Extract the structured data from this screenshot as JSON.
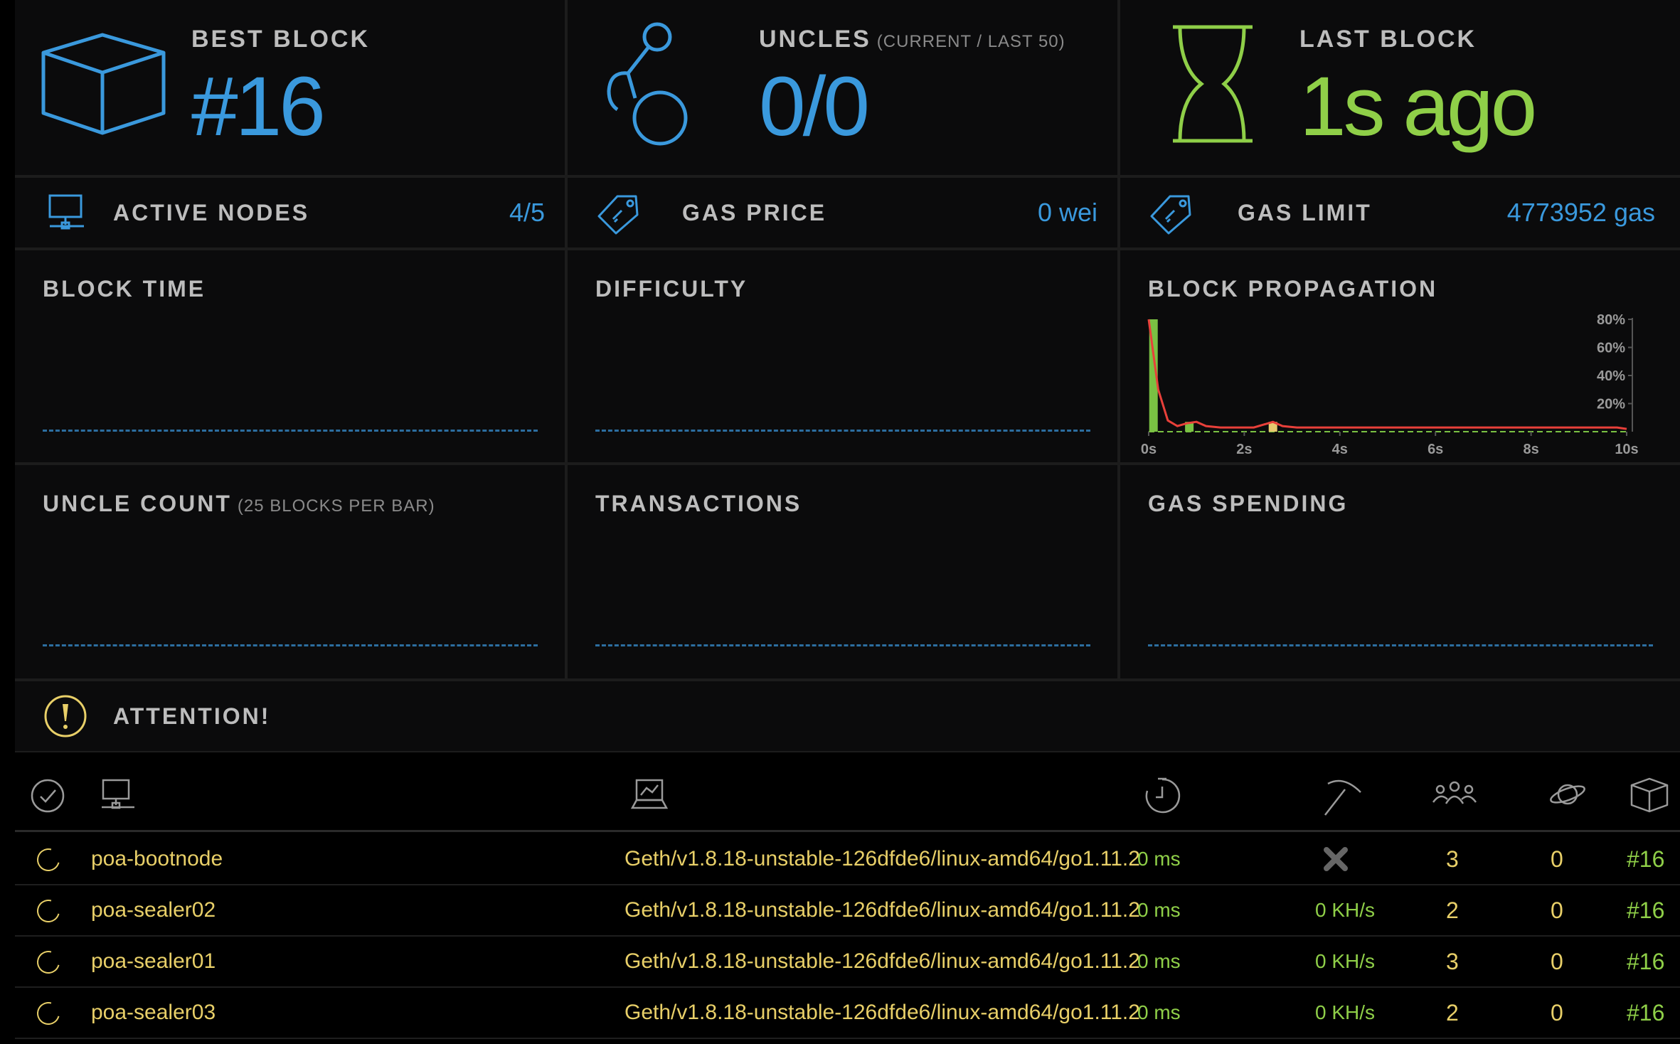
{
  "stats": {
    "best_block": {
      "label": "BEST BLOCK",
      "value": "#16"
    },
    "uncles": {
      "label": "UNCLES",
      "sublabel": "(CURRENT / LAST 50)",
      "value": "0/0"
    },
    "last_block": {
      "label": "LAST BLOCK",
      "value": "1s ago"
    },
    "active_nodes": {
      "label": "ACTIVE NODES",
      "value": "4/5"
    },
    "gas_price": {
      "label": "GAS PRICE",
      "value": "0 wei"
    },
    "gas_limit": {
      "label": "GAS LIMIT",
      "value": "4773952 gas"
    }
  },
  "charts": {
    "block_time": {
      "label": "BLOCK TIME"
    },
    "difficulty": {
      "label": "DIFFICULTY"
    },
    "uncle_count": {
      "label": "UNCLE COUNT",
      "sublabel": "(25 BLOCKS PER BAR)"
    },
    "transactions": {
      "label": "TRANSACTIONS"
    },
    "gas_spending": {
      "label": "GAS SPENDING"
    },
    "block_propagation": {
      "label": "BLOCK PROPAGATION"
    }
  },
  "chart_data": {
    "type": "bar",
    "title": "BLOCK PROPAGATION",
    "x_unit": "s",
    "x_ticks": [
      "0s",
      "2s",
      "4s",
      "6s",
      "8s",
      "10s"
    ],
    "y_ticks": [
      "80%",
      "60%",
      "40%",
      "20%"
    ],
    "xlim": [
      0,
      10
    ],
    "ylim": [
      0,
      80
    ],
    "bars": [
      {
        "x": 0.1,
        "value": 80,
        "color": "#7ac143"
      },
      {
        "x": 0.85,
        "value": 7,
        "color": "#7ac143"
      },
      {
        "x": 2.6,
        "value": 7,
        "color": "#e6c86e"
      }
    ],
    "curve": [
      [
        0,
        80
      ],
      [
        0.2,
        30
      ],
      [
        0.4,
        8
      ],
      [
        0.6,
        4
      ],
      [
        0.8,
        6
      ],
      [
        1.0,
        7
      ],
      [
        1.2,
        4
      ],
      [
        1.5,
        3
      ],
      [
        2.2,
        3
      ],
      [
        2.5,
        6
      ],
      [
        2.6,
        7
      ],
      [
        2.8,
        4
      ],
      [
        3.1,
        3
      ],
      [
        5,
        3
      ],
      [
        8,
        3
      ],
      [
        9.8,
        3
      ],
      [
        10,
        2
      ]
    ],
    "curve_color": "#e8403a",
    "grid": false
  },
  "attention": {
    "label": "ATTENTION!"
  },
  "nodes": [
    {
      "name": "poa-bootnode",
      "client": "Geth/v1.8.18-unstable-126dfde6/linux-amd64/go1.11.2",
      "latency": "0 ms",
      "hashrate": "",
      "mining_icon": "cross-icon",
      "peers": "3",
      "pending": "0",
      "block": "#16"
    },
    {
      "name": "poa-sealer02",
      "client": "Geth/v1.8.18-unstable-126dfde6/linux-amd64/go1.11.2",
      "latency": "0 ms",
      "hashrate": "0 KH/s",
      "mining_icon": "",
      "peers": "2",
      "pending": "0",
      "block": "#16"
    },
    {
      "name": "poa-sealer01",
      "client": "Geth/v1.8.18-unstable-126dfde6/linux-amd64/go1.11.2",
      "latency": "0 ms",
      "hashrate": "0 KH/s",
      "mining_icon": "",
      "peers": "3",
      "pending": "0",
      "block": "#16"
    },
    {
      "name": "poa-sealer03",
      "client": "Geth/v1.8.18-unstable-126dfde6/linux-amd64/go1.11.2",
      "latency": "0 ms",
      "hashrate": "0 KH/s",
      "mining_icon": "",
      "peers": "2",
      "pending": "0",
      "block": "#16"
    }
  ],
  "colors": {
    "blue": "#3a99dd",
    "green": "#8fcf48",
    "yellow": "#e8cf68",
    "red": "#e8403a"
  }
}
